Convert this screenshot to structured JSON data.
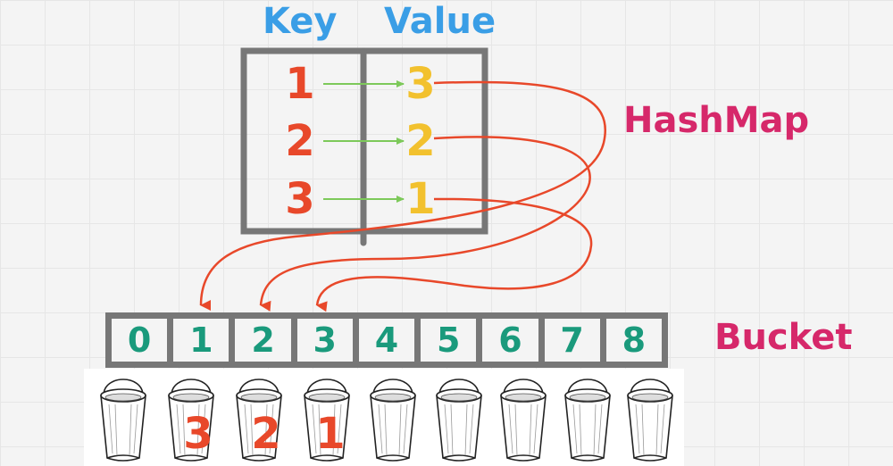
{
  "headers": {
    "key": "Key",
    "value": "Value"
  },
  "hashmap_title": "HashMap",
  "bucket_title": "Bucket",
  "entries": [
    {
      "key": "1",
      "value": "3"
    },
    {
      "key": "2",
      "value": "2"
    },
    {
      "key": "3",
      "value": "1"
    }
  ],
  "buckets": [
    "0",
    "1",
    "2",
    "3",
    "4",
    "5",
    "6",
    "7",
    "8"
  ],
  "bucket_contents": [
    {
      "bucket": "1",
      "label": "3"
    },
    {
      "bucket": "2",
      "label": "2"
    },
    {
      "bucket": "3",
      "label": "1"
    }
  ],
  "colors": {
    "header": "#3a9ee6",
    "title": "#d6286a",
    "key": "#e8482a",
    "value": "#f2c12e",
    "bucket_index": "#1a9a7c",
    "key_arrow": "#7dc95a",
    "bucket_arrow": "#e8482a",
    "frame": "#777777"
  }
}
